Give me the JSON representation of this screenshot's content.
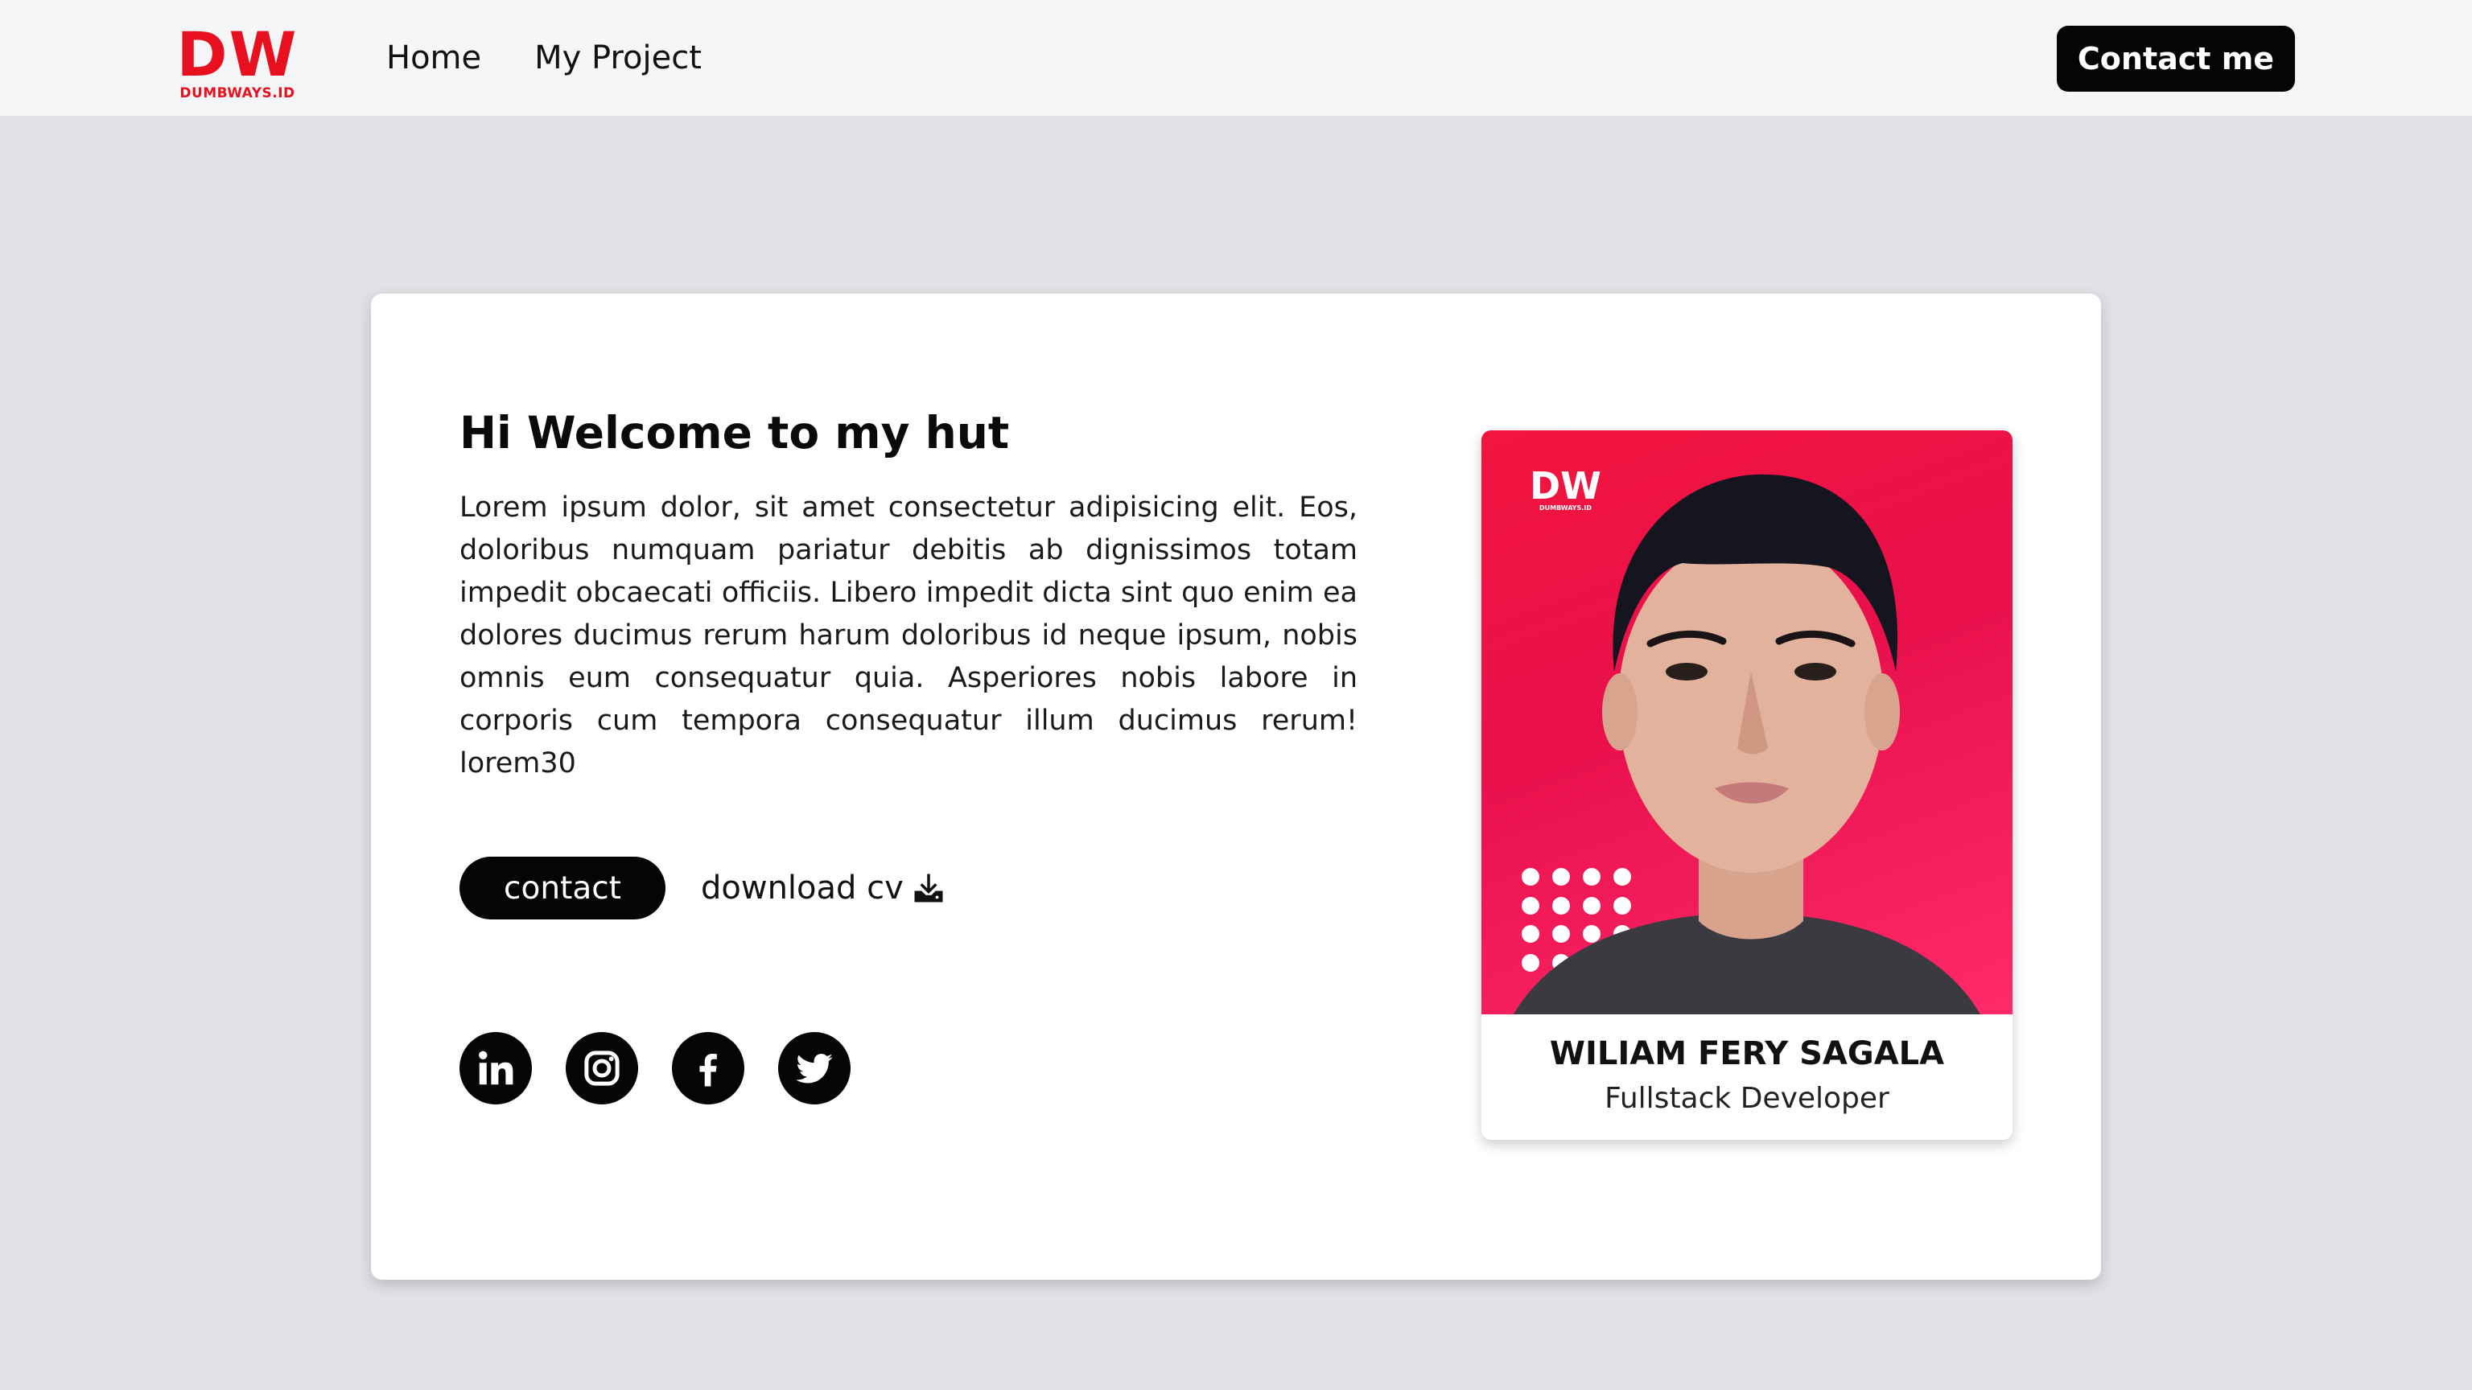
{
  "navbar": {
    "logo": {
      "main": "DW",
      "sub": "DUMBWAYS.ID"
    },
    "links": [
      {
        "label": "Home"
      },
      {
        "label": "My Project"
      }
    ],
    "contact_button": "Contact me"
  },
  "hero": {
    "title": "Hi Welcome to my hut",
    "description": "Lorem ipsum dolor, sit amet consectetur adipisicing elit. Eos, doloribus numquam pariatur debitis ab dignissimos totam impedit obcaecati officiis. Libero impedit dicta sint quo enim ea dolores ducimus rerum harum doloribus id neque ipsum, nobis omnis eum consequatur quia. Asperiores nobis labore in corporis cum tempora consequatur illum ducimus rerum! lorem30",
    "contact_button": "contact",
    "download_link": "download cv",
    "socials": [
      {
        "icon": "linkedin-icon"
      },
      {
        "icon": "instagram-icon"
      },
      {
        "icon": "facebook-icon"
      },
      {
        "icon": "twitter-icon"
      }
    ]
  },
  "profile": {
    "photo_logo": {
      "main": "DW",
      "sub": "DUMBWAYS.ID"
    },
    "name": "WILIAM FERY SAGALA",
    "role": "Fullstack Developer"
  },
  "colors": {
    "brand_red": "#e8101e",
    "photo_bg": "#f3153e",
    "page_bg": "#e0e2e6",
    "button_dark": "#050505"
  }
}
